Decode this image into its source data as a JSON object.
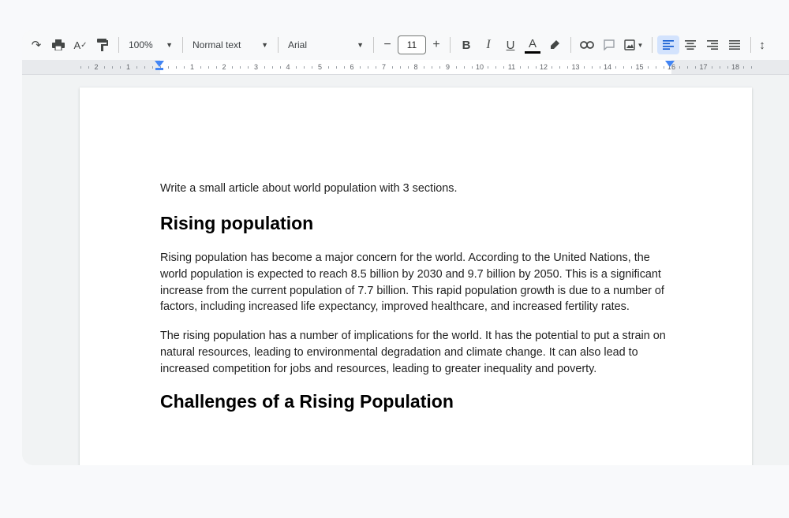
{
  "toolbar": {
    "zoom": "100%",
    "style": "Normal text",
    "font": "Arial",
    "font_size": "11",
    "minus": "−",
    "plus": "+",
    "bold": "B",
    "italic": "I",
    "underline": "U",
    "text_color": "A"
  },
  "ruler": {
    "labels": [
      "2",
      "1",
      "1",
      "2",
      "3",
      "4",
      "5",
      "6",
      "7",
      "8",
      "9",
      "10",
      "11",
      "12",
      "13",
      "14",
      "15",
      "16",
      "17",
      "18"
    ]
  },
  "document": {
    "prompt": "Write a small article about world population with 3 sections.",
    "section1_heading": "Rising population",
    "para1": "Rising population has become a major concern for the world. According to the United Nations, the world population is expected to reach 8.5 billion by 2030 and 9.7 billion by 2050. This is a significant increase from the current population of 7.7 billion. This rapid population growth is due to a number of factors, including increased life expectancy, improved healthcare, and increased fertility rates.",
    "para2": "The rising population has a number of implications for the world. It has the potential to put a strain on natural resources, leading to environmental degradation and climate change. It can also lead to increased competition for jobs and resources, leading to greater inequality and poverty.",
    "section2_heading": "Challenges of a Rising Population"
  },
  "colors": {
    "accent": "#0b57d0",
    "accent_bg": "#d3e3fd",
    "ruler_marker": "#4285f4"
  }
}
